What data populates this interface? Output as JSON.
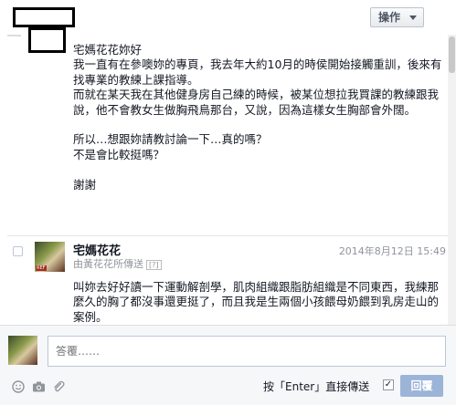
{
  "header": {
    "actions_label": "操作"
  },
  "conversation": {
    "message1": {
      "lines": [
        "宅媽花花妳好",
        "我一直有在參噢妳的專頁，我去年大約10月的時侯開始接觸重訓，後來有找專業的教練上課指導。",
        "而就在某天我在其他健身房自己練的時候，被某位想拉我買課的教練跟我說，他不會教女生做胸飛鳥那台，又說，因為這樣女生胸部會外闊。",
        "",
        "所以…想跟妳請教討論一下…真的嗎？",
        "不是會比較挺嗎？",
        "",
        "謝謝"
      ]
    },
    "message2": {
      "sender": "宅媽花花",
      "via": "由黃花花所傳送",
      "via_help": "[?]",
      "timestamp": "2014年8月12日 15:49",
      "avatar_tag": "REF",
      "text": "叫妳去好好讀一下運動解剖學，肌肉組織跟脂肪組織是不同東西，我練那麼久的胸了都沒事還更挺了，而且我是生兩個小孩餵母奶餵到乳房走山的案例。"
    }
  },
  "composer": {
    "placeholder": "答覆……",
    "enter_label": "按「Enter」直接傳送",
    "enter_checked": "✓",
    "reply_label": "回覆",
    "icons": [
      "emoji-icon",
      "camera-icon",
      "attach-icon"
    ]
  }
}
